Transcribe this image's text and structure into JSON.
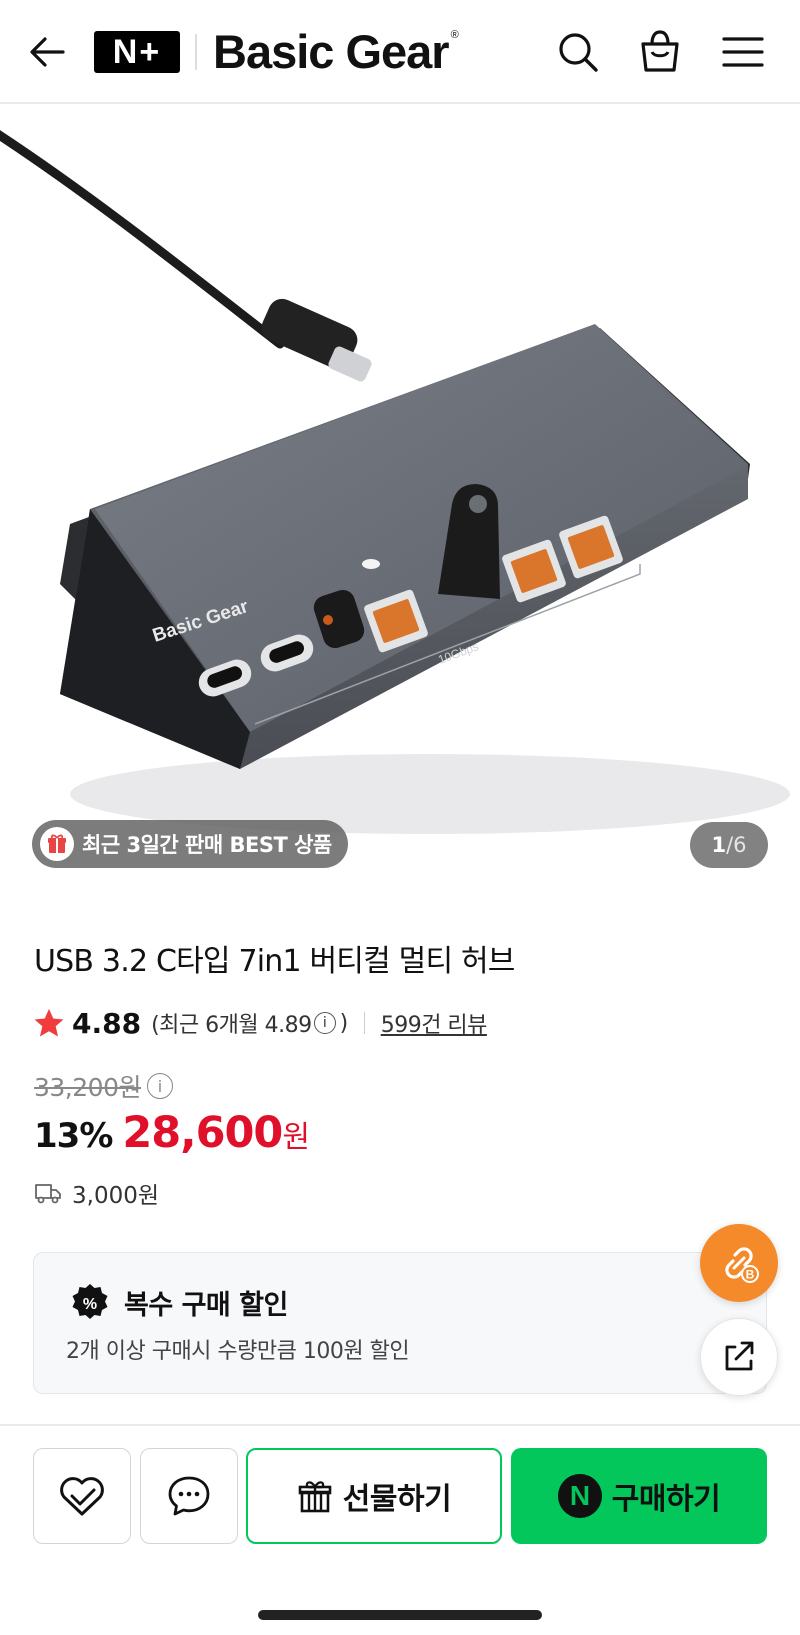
{
  "header": {
    "logo_text": "N+",
    "brand": "Basic Gear",
    "brand_mark": "®",
    "icons": [
      "back-arrow-icon",
      "search-icon",
      "shopping-bag-icon",
      "hamburger-menu-icon"
    ]
  },
  "hero": {
    "image_alt": "USB hub product photo",
    "product_print": "Basic Gear",
    "port_label": "10Gbps",
    "badge_text": "최근 3일간 판매 BEST 상품",
    "pager_current": "1",
    "pager_sep": "/",
    "pager_total": "6"
  },
  "product": {
    "title": "USB 3.2 C타입 7in1 버티컬 멀티 허브",
    "rating": "4.88",
    "recent_rating": "(최근 6개월 4.89",
    "recent_close": ")",
    "reviews": "599건 리뷰",
    "original_price": "33,200원",
    "discount": "13%",
    "price": "28,600",
    "price_unit": "원",
    "shipping": "3,000원"
  },
  "promo": {
    "title": "복수 구매 할인",
    "description": "2개 이상 구매시 수량만큼 100원 할인"
  },
  "actions": {
    "gift_label": "선물하기",
    "buy_label": "구매하기",
    "buy_badge": "N"
  },
  "colors": {
    "accent_green": "#03c75a",
    "price_red": "#e0102a",
    "fab_orange": "#f58a2a"
  }
}
